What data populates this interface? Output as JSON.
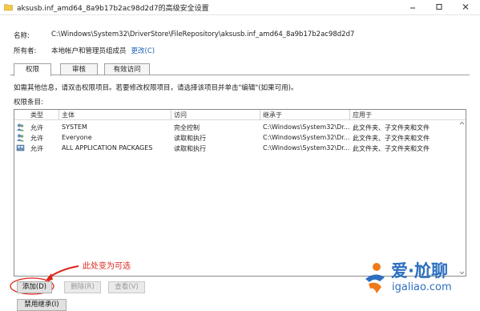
{
  "window": {
    "title": "aksusb.inf_amd64_8a9b17b2ac98d2d7的高级安全设置"
  },
  "info": {
    "name_label": "名称:",
    "name_value": "C:\\Windows\\System32\\DriverStore\\FileRepository\\aksusb.inf_amd64_8a9b17b2ac98d2d7",
    "owner_label": "所有者:",
    "owner_value": "本地帐户和管理员组成员",
    "change_link": "更改(C)"
  },
  "tabs": [
    {
      "label": "权限",
      "active": true
    },
    {
      "label": "审核",
      "active": false
    },
    {
      "label": "有效访问",
      "active": false
    }
  ],
  "description": "如需其他信息，请双击权限项目。若要修改权限项目，请选择该项目并单击\"编辑\"(如果可用)。",
  "entries_label": "权限条目:",
  "columns": {
    "type": "类型",
    "principal": "主体",
    "access": "访问",
    "inherited_from": "继承于",
    "applies_to": "应用于"
  },
  "rows": [
    {
      "icon": "user-group-icon",
      "type": "允许",
      "principal": "SYSTEM",
      "access": "完全控制",
      "inherited_from": "C:\\Windows\\System32\\Dr...",
      "applies_to": "此文件夹、子文件夹和文件"
    },
    {
      "icon": "user-group-icon",
      "type": "允许",
      "principal": "Everyone",
      "access": "读取和执行",
      "inherited_from": "C:\\Windows\\System32\\Dr...",
      "applies_to": "此文件夹、子文件夹和文件"
    },
    {
      "icon": "app-package-icon",
      "type": "允许",
      "principal": "ALL APPLICATION PACKAGES",
      "access": "读取和执行",
      "inherited_from": "C:\\Windows\\System32\\Dr...",
      "applies_to": "此文件夹、子文件夹和文件"
    }
  ],
  "annotation": "此处变为可选",
  "buttons": {
    "add": "添加(D)",
    "remove": "删除(R)",
    "view": "查看(V)",
    "disable_inheritance": "禁用继承(I)"
  },
  "watermark": {
    "main": "爱·尬聊",
    "url": "igaliao.com"
  },
  "colors": {
    "annotation_red": "#e0231a",
    "link_blue": "#1b5fb6",
    "watermark_blue": "#2d6fbf",
    "watermark_orange": "#f07a1a"
  }
}
